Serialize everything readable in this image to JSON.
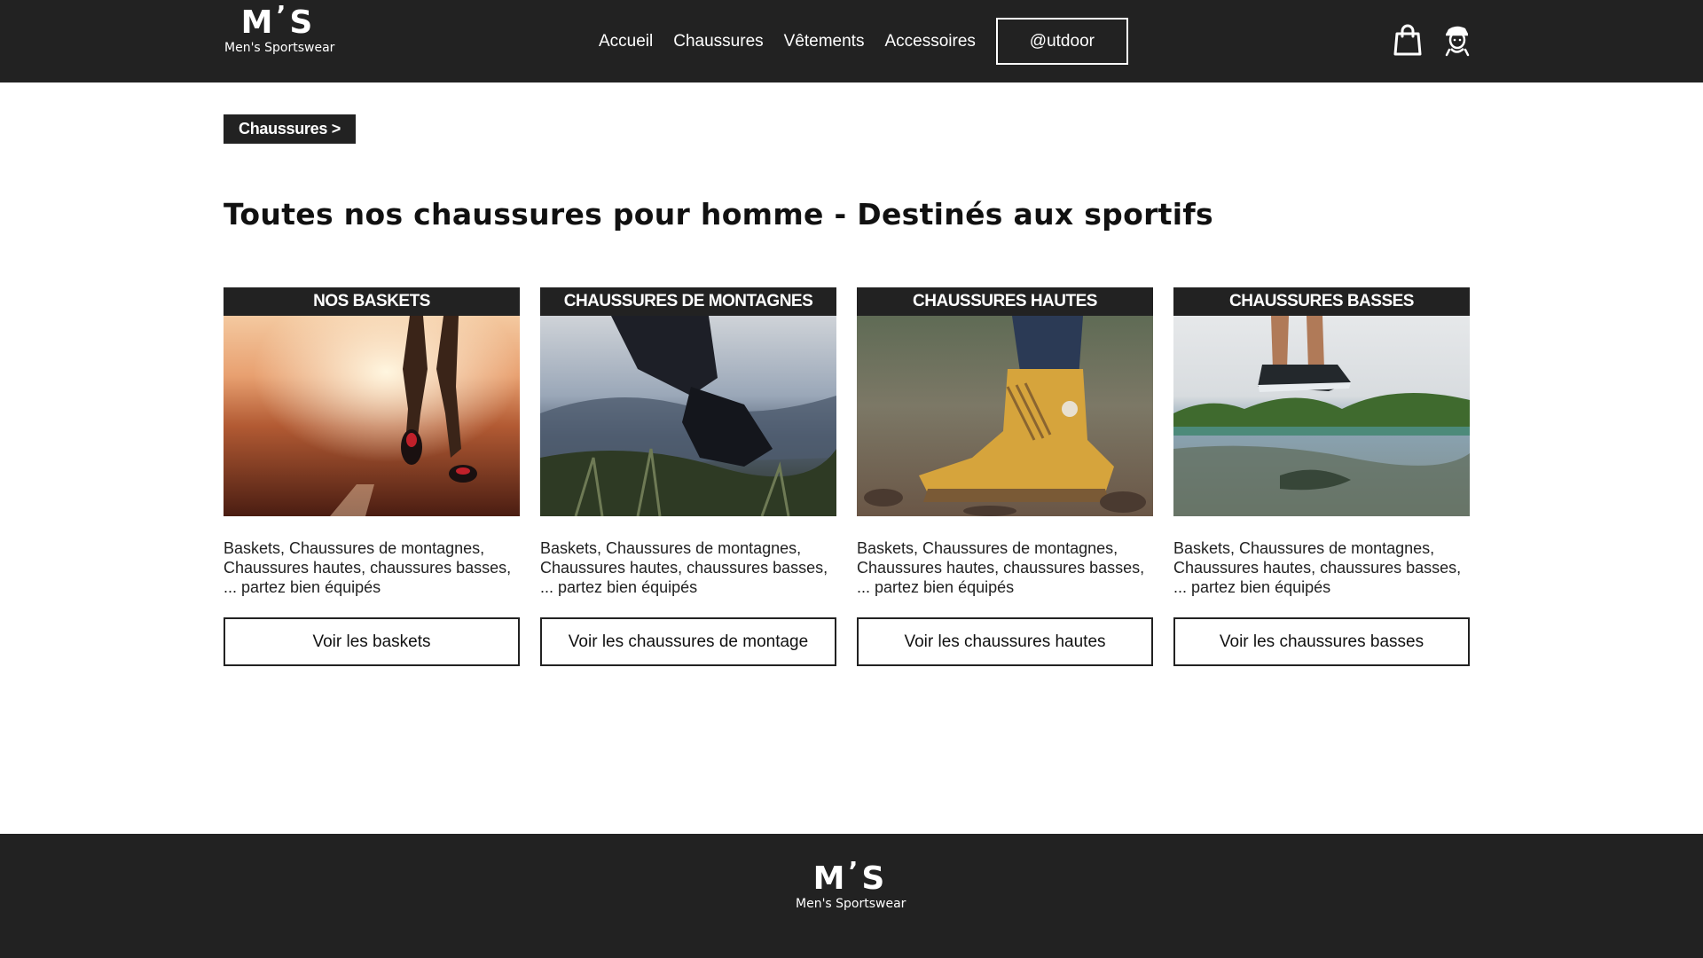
{
  "brand": {
    "mark_left": "M",
    "mark_apos": "’",
    "mark_right": "S",
    "name": "Men's Sportswear"
  },
  "nav": {
    "links": [
      "Accueil",
      "Chaussures",
      "Vêtements",
      "Accessoires"
    ],
    "outdoor": "@utdoor"
  },
  "icons": {
    "cart": "shopping-bag-icon",
    "user": "user-avatar-icon"
  },
  "breadcrumb": "Chaussures >",
  "page_title": "Toutes nos chaussures pour homme - Destinés aux sportifs",
  "cards": [
    {
      "title": "NOS BASKETS",
      "image": "runner-on-road-at-sunset",
      "description": "Baskets, Chaussures de montagnes, Chaussures hautes, chaussures basses, ... partez bien équipés",
      "button": "Voir les baskets"
    },
    {
      "title": "CHAUSSURES DE MONTAGNES",
      "image": "hiker-boot-on-mountain",
      "description": "Baskets, Chaussures de montagnes, Chaussures hautes, chaussures basses, ... partez bien équipés",
      "button": "Voir les chaussures de montage"
    },
    {
      "title": "CHAUSSURES HAUTES",
      "image": "yellow-high-boot-on-rocks",
      "description": "Baskets, Chaussures de montagnes, Chaussures hautes, chaussures basses, ... partez bien équipés",
      "button": "Voir les chaussures hautes"
    },
    {
      "title": "CHAUSSURES BASSES",
      "image": "sneaker-jumping-over-puddle",
      "description": "Baskets, Chaussures de montagnes, Chaussures hautes, chaussures basses, ... partez bien équipés",
      "button": "Voir les chaussures basses"
    }
  ],
  "colors": {
    "dark": "#222222",
    "white": "#ffffff",
    "text": "#111111"
  }
}
